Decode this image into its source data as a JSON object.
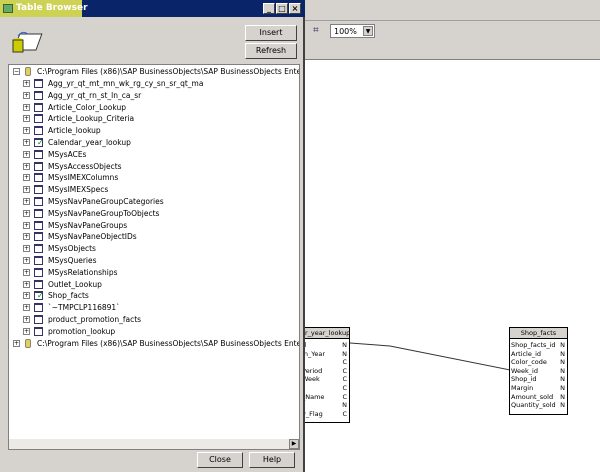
{
  "dialog": {
    "title": "Table Browser",
    "insert": "Insert",
    "refresh": "Refresh",
    "close": "Close",
    "help": "Help",
    "window_buttons": [
      "_",
      "□",
      "×"
    ]
  },
  "toolbar": {
    "zoom": "100%"
  },
  "tree": {
    "root1": "C:\\Program Files (x86)\\SAP BusinessObjects\\SAP BusinessObjects Enterprise :",
    "root2": "C:\\Program Files (x86)\\SAP BusinessObjects\\SAP BusinessObjects Enterprise :",
    "items": [
      {
        "label": "Agg_yr_qt_mt_mn_wk_rg_cy_sn_sr_qt_ma",
        "checked": false
      },
      {
        "label": "Agg_yr_qt_rn_st_ln_ca_sr",
        "checked": false
      },
      {
        "label": "Article_Color_Lookup",
        "checked": false
      },
      {
        "label": "Article_Lookup_Criteria",
        "checked": false
      },
      {
        "label": "Article_lookup",
        "checked": false
      },
      {
        "label": "Calendar_year_lookup",
        "checked": true
      },
      {
        "label": "MSysACEs",
        "checked": false
      },
      {
        "label": "MSysAccessObjects",
        "checked": false
      },
      {
        "label": "MSysIMEXColumns",
        "checked": false
      },
      {
        "label": "MSysIMEXSpecs",
        "checked": false
      },
      {
        "label": "MSysNavPaneGroupCategories",
        "checked": false
      },
      {
        "label": "MSysNavPaneGroupToObjects",
        "checked": false
      },
      {
        "label": "MSysNavPaneGroups",
        "checked": false
      },
      {
        "label": "MSysNavPaneObjectIDs",
        "checked": false
      },
      {
        "label": "MSysObjects",
        "checked": false
      },
      {
        "label": "MSysQueries",
        "checked": false
      },
      {
        "label": "MSysRelationships",
        "checked": false
      },
      {
        "label": "Outlet_Lookup",
        "checked": false
      },
      {
        "label": "Shop_facts",
        "checked": true
      },
      {
        "label": "`~TMPCLP116891`",
        "checked": false
      },
      {
        "label": "product_promotion_facts",
        "checked": false
      },
      {
        "label": "promotion_lookup",
        "checked": false
      }
    ]
  },
  "entities": [
    {
      "title": "ar_year_lookup",
      "fields": [
        [
          "d",
          "N"
        ],
        [
          "In_Year",
          "N"
        ],
        [
          "",
          "C"
        ],
        [
          "Period",
          "C"
        ],
        [
          "Week",
          "C"
        ],
        [
          "",
          "C"
        ],
        [
          "_Name",
          "C"
        ],
        [
          "",
          "N"
        ],
        [
          "y_Flag",
          "C"
        ]
      ]
    },
    {
      "title": "Shop_facts",
      "fields": [
        [
          "Shop_facts_id",
          "N"
        ],
        [
          "Article_id",
          "N"
        ],
        [
          "Color_code",
          "N"
        ],
        [
          "Week_id",
          "N"
        ],
        [
          "Shop_id",
          "N"
        ],
        [
          "Margin",
          "N"
        ],
        [
          "Amount_sold",
          "N"
        ],
        [
          "Quantity_sold",
          "N"
        ]
      ]
    }
  ]
}
